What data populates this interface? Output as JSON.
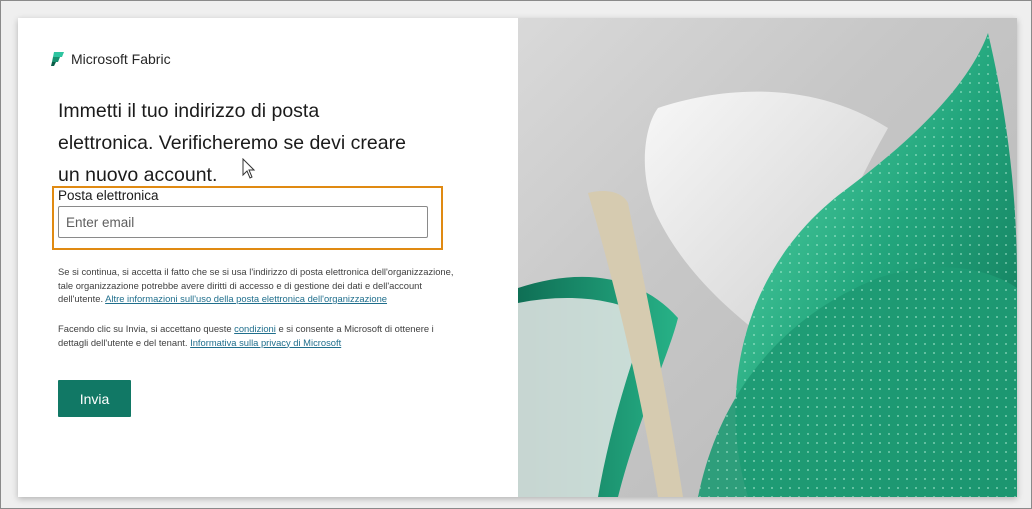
{
  "brand": {
    "name": "Microsoft Fabric",
    "icon": "fabric-logo-icon",
    "accent_color": "#117865"
  },
  "heading": {
    "lines": [
      "Immetti il tuo indirizzo di posta",
      "elettronica. Verificheremo se devi creare",
      "un nuovo account."
    ]
  },
  "email": {
    "label": "Posta elettronica",
    "placeholder": "Enter email",
    "value": ""
  },
  "notice": {
    "line1": "Se si continua, si accetta il fatto che se si usa l'indirizzo di posta elettronica dell'organizzazione,",
    "line2": "tale organizzazione potrebbe avere diritti di accesso e di gestione dei dati e dell'account",
    "line3_text": "dell'utente.",
    "link": "Altre informazioni sull'uso della posta elettronica dell'organizzazione"
  },
  "consent": {
    "part1": "Facendo clic su Invia, si accettano queste",
    "link_terms": "condizioni",
    "part2": "e si consente a Microsoft di ottenere i",
    "part3": "dettagli dell'utente e del tenant.",
    "link_privacy": "Informativa sulla privacy di Microsoft"
  },
  "submit": {
    "label": "Invia"
  },
  "highlight_color": "#e08a12"
}
